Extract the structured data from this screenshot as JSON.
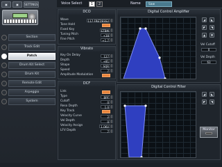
{
  "sidebar": {
    "top_icons": [
      "▣",
      "▣",
      "SETTINGS"
    ],
    "items": [
      "Section",
      "Track Edit",
      "Patch",
      "Drum Kit Select",
      "Drum Kit",
      "Remote Edit",
      "Arpeggio",
      "System"
    ],
    "active_index": 2
  },
  "header": {
    "voice_select_label": "Voice Select",
    "voice_buttons": [
      "1",
      "2"
    ],
    "active_voice": "1",
    "name_label": "Name",
    "voice_name": "Saw"
  },
  "dco": {
    "title": "DCO",
    "rows": [
      {
        "label": "Wave",
        "value": "117 FRET/ESS2"
      },
      {
        "label": "Tone Hold",
        "value": ""
      },
      {
        "label": "Fixed Key",
        "value": "ETBM"
      },
      {
        "label": "Tuning Pitch",
        "value": "+38"
      },
      {
        "label": "Fine Pitch",
        "value": "+1.7"
      }
    ]
  },
  "vibrato": {
    "title": "Vibrato",
    "rows": [
      {
        "label": "Key On Delay",
        "value": "127"
      },
      {
        "label": "Depth",
        "value": "+81"
      },
      {
        "label": "Shape",
        "value": "SQR"
      },
      {
        "label": "Speed",
        "value": "7"
      },
      {
        "label": "Amplitude Modulation",
        "value": ""
      }
    ]
  },
  "dcf": {
    "title": "DCF",
    "rows": [
      {
        "label": "Link",
        "value": ""
      },
      {
        "label": "Type",
        "value": "BPF"
      },
      {
        "label": "Cutoff",
        "value": "0"
      },
      {
        "label": "Reso Depth",
        "value": "1.0"
      },
      {
        "label": "Key Track",
        "value": ""
      },
      {
        "label": "Velocity Curve",
        "value": "2"
      },
      {
        "label": "Vel Depth",
        "value": "0"
      },
      {
        "label": "Velocity Assign",
        "value": "1.0KV"
      },
      {
        "label": "LFV Depth",
        "value": "7"
      }
    ]
  },
  "dca_panel": {
    "title": "Digital Control Amplifier",
    "vel_cutoff_label": "Vel Cutoff",
    "vel_cutoff_value": "0",
    "vel_depth_label": "Vel Depth",
    "vel_depth_value": "63"
  },
  "dcf_panel": {
    "title": "Digital Control Filter"
  },
  "monitor": {
    "label": "Monitor"
  },
  "colors": {
    "accent": "#e9843b",
    "envelope_fill": "#2f3fc0",
    "envelope_stroke": "#7f8ff5"
  }
}
